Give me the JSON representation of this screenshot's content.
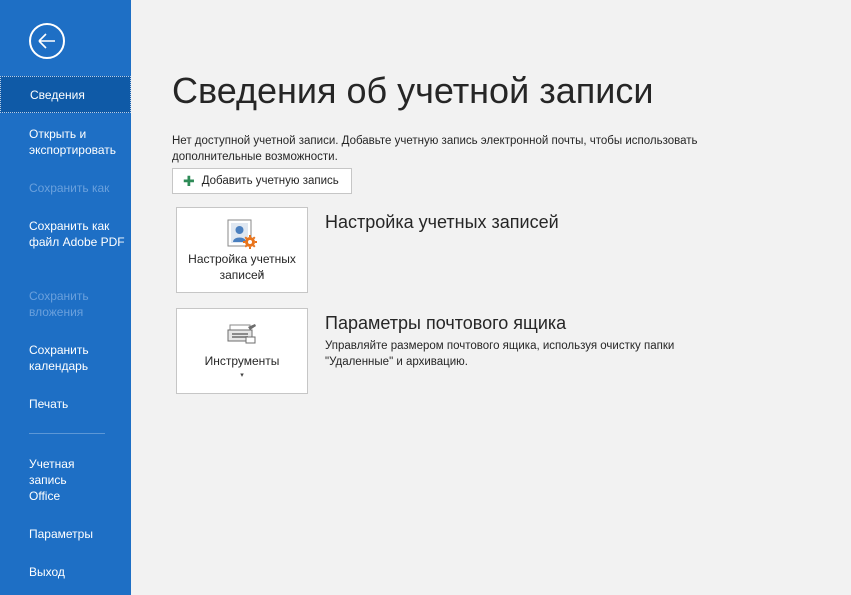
{
  "sidebar": {
    "back_label": "Назад",
    "items": [
      {
        "label": "Сведения"
      },
      {
        "label": "Открыть и экспортировать"
      },
      {
        "label": "Сохранить как"
      },
      {
        "label": "Сохранить как файл Adobe PDF"
      },
      {
        "label": "Сохранить вложения"
      },
      {
        "label": "Сохранить календарь"
      },
      {
        "label": "Печать"
      },
      {
        "label": "Учетная запись Office"
      },
      {
        "label": "Параметры"
      },
      {
        "label": "Выход"
      }
    ]
  },
  "main": {
    "title": "Сведения об учетной записи",
    "info_text": "Нет доступной учетной записи. Добавьте учетную запись электронной почты, чтобы использовать дополнительные возможности.",
    "add_account_label": "Добавить учетную запись",
    "sections": [
      {
        "tile_label": "Настройка учетных записей",
        "title": "Настройка учетных записей",
        "description": ""
      },
      {
        "tile_label": "Инструменты",
        "title": "Параметры почтового ящика",
        "description": "Управляйте размером почтового ящика, используя очистку папки \"Удаленные\" и архивацию."
      }
    ]
  },
  "colors": {
    "sidebar_bg": "#1e6fc5",
    "sidebar_selected": "#0f5aa7",
    "sidebar_disabled_text": "#6aa0dc",
    "main_bg": "#f2f2f2",
    "accent_orange": "#e8741c",
    "add_icon_green": "#2e8b57"
  },
  "icons": {
    "back": "back-arrow-icon",
    "add": "plus-icon",
    "account_settings": "account-settings-icon",
    "tools": "tools-icon"
  }
}
